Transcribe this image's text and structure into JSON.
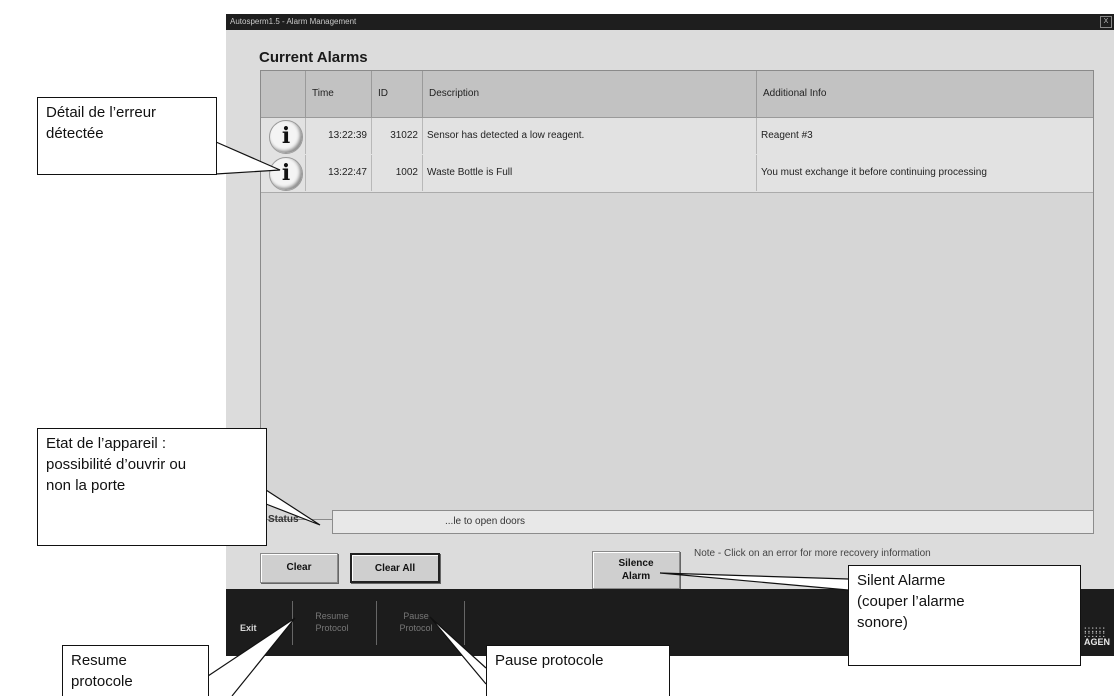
{
  "window": {
    "title": "Autosperm1.5 - Alarm Management",
    "close_label": "X"
  },
  "alarms": {
    "title": "Current Alarms",
    "columns": [
      "",
      "Time",
      "ID",
      "Description",
      "Additional Info"
    ],
    "rows": [
      {
        "icon": "i",
        "time": "13:22:39",
        "id": "31022",
        "description": "Sensor has detected a low reagent.",
        "info": "Reagent #3"
      },
      {
        "icon": "i",
        "time": "13:22:47",
        "id": "1002",
        "description": "Waste Bottle is Full",
        "info": "You must exchange it before continuing processing"
      }
    ]
  },
  "status": {
    "label": "Status",
    "value": "...le to open doors"
  },
  "buttons": {
    "clear": "Clear",
    "clear_all": "Clear All",
    "silence_line1": "Silence",
    "silence_line2": "Alarm"
  },
  "note": "Note - Click on an error for more recovery information",
  "bottom": {
    "exit": "Exit",
    "resume_line1": "Resume",
    "resume_line2": "Protocol",
    "pause_line1": "Pause",
    "pause_line2": "Protocol",
    "logo_text": "AGEN"
  },
  "callouts": {
    "error_detail": [
      "Détail de l’erreur",
      "détectée"
    ],
    "device_state": [
      "Etat de l’appareil :",
      "possibilité d’ouvrir ou",
      "non la porte"
    ],
    "silent_alarm": [
      "Silent Alarme",
      "(couper l’alarme",
      "sonore)"
    ],
    "resume": [
      "Resume",
      "protocole"
    ],
    "pause": [
      "Pause protocole"
    ]
  }
}
